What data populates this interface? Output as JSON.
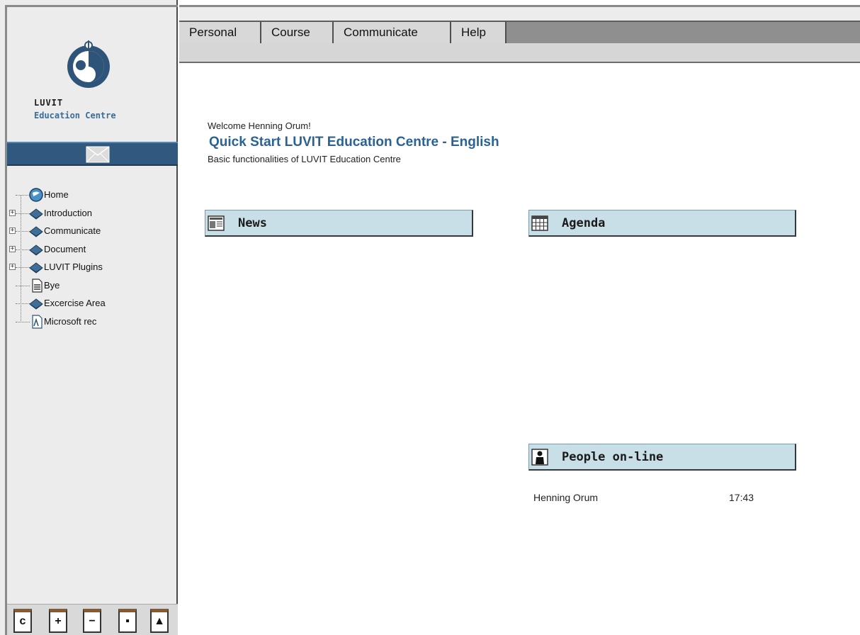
{
  "brand": {
    "name_line1": "LUVIT",
    "name_line2": "Education Centre",
    "logo_icon": "luvit-globe-logo"
  },
  "mail_icon": "envelope-icon",
  "menu": [
    "Personal",
    "Course",
    "Communicate",
    "Help"
  ],
  "tree": [
    {
      "label": "Home",
      "icon": "globe-icon",
      "expandable": false
    },
    {
      "label": "Introduction",
      "icon": "book-icon",
      "expandable": true
    },
    {
      "label": "Communicate",
      "icon": "book-icon",
      "expandable": true
    },
    {
      "label": "Document",
      "icon": "book-icon",
      "expandable": true
    },
    {
      "label": "LUVIT Plugins",
      "icon": "book-icon",
      "expandable": true
    },
    {
      "label": "Bye",
      "icon": "document-icon",
      "expandable": false
    },
    {
      "label": "Excercise Area",
      "icon": "book-icon",
      "expandable": false
    },
    {
      "label": "Microsoft rec",
      "icon": "file-icon",
      "expandable": false
    }
  ],
  "toolbar": [
    {
      "glyph": "c",
      "icon": "refresh-icon"
    },
    {
      "glyph": "+",
      "icon": "expand-all-icon"
    },
    {
      "glyph": "−",
      "icon": "collapse-all-icon"
    },
    {
      "glyph": "▪",
      "icon": "window-icon"
    },
    {
      "glyph": "▲",
      "icon": "person-icon"
    }
  ],
  "content": {
    "welcome": "Welcome Henning Orum!",
    "course_title": "Quick Start LUVIT Education Centre - English",
    "course_description": "Basic functionalities of LUVIT Education Centre"
  },
  "panels": {
    "news": "News",
    "agenda": "Agenda",
    "people": "People on-line"
  },
  "people_online": [
    {
      "name": "Henning Orum",
      "time": "17:43"
    }
  ],
  "colors": {
    "accent_blue": "#2a6393",
    "mail_bar": "#31587f",
    "panel_header": "#c9dfe8"
  }
}
